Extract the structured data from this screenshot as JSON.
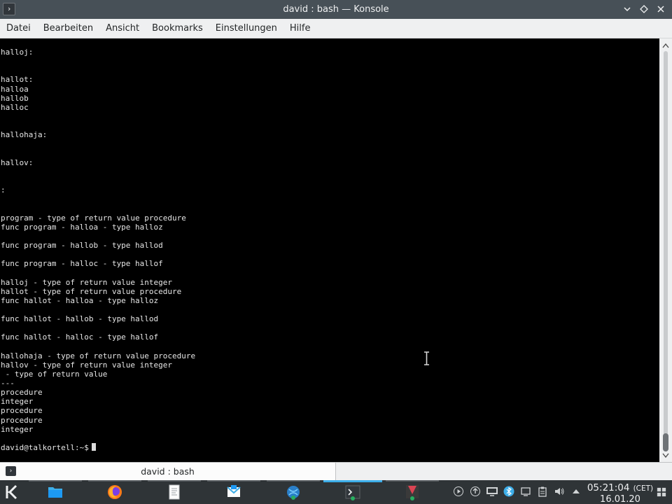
{
  "window": {
    "title": "david : bash — Konsole",
    "app_icon": "terminal-icon",
    "controls": [
      "chevron-down-icon",
      "keep-above-icon",
      "close-icon"
    ]
  },
  "menubar": {
    "items": [
      "Datei",
      "Bearbeiten",
      "Ansicht",
      "Bookmarks",
      "Einstellungen",
      "Hilfe"
    ]
  },
  "terminal": {
    "lines": [
      "halloj:",
      "",
      "",
      "hallot:",
      "halloa",
      "hallob",
      "halloc",
      "",
      "",
      "hallohaja:",
      "",
      "",
      "hallov:",
      "",
      "",
      ":",
      "",
      "",
      "program - type of return value procedure",
      "func program - halloa - type halloz",
      "",
      "func program - hallob - type hallod",
      "",
      "func program - halloc - type hallof",
      "",
      "halloj - type of return value integer",
      "hallot - type of return value procedure",
      "func hallot - halloa - type halloz",
      "",
      "func hallot - hallob - type hallod",
      "",
      "func hallot - halloc - type hallof",
      "",
      "hallohaja - type of return value procedure",
      "hallov - type of return value integer",
      " - type of return value",
      "---",
      "procedure",
      "integer",
      "procedure",
      "procedure",
      "integer",
      ""
    ],
    "prompt": "david@talkortell:~$",
    "colors": {
      "background": "#000000",
      "foreground": "#e6e6e6"
    }
  },
  "tabs": [
    {
      "label": "david : bash",
      "icon": "terminal-icon",
      "active": true
    }
  ],
  "taskbar": {
    "launcher_icon": "kde-kickoff-icon",
    "tasks": [
      {
        "icon": "folder-icon",
        "active": false
      },
      {
        "icon": "firefox-icon",
        "active": false
      },
      {
        "icon": "text-editor-icon",
        "active": false
      },
      {
        "icon": "mail-icon",
        "active": false
      },
      {
        "icon": "network-icon",
        "active": false
      },
      {
        "icon": "terminal-icon",
        "active": true
      },
      {
        "icon": "red-app-icon",
        "active": false
      }
    ],
    "tray_icons": [
      "media-play-icon",
      "update-icon",
      "display-icon",
      "bluetooth-icon",
      "clipboard-icon",
      "notes-icon",
      "volume-icon",
      "expand-tray-icon"
    ],
    "clock": {
      "time": "05:21:04",
      "tz": "(CET)",
      "date": "16.01.20"
    },
    "accent": "#3daee9"
  }
}
